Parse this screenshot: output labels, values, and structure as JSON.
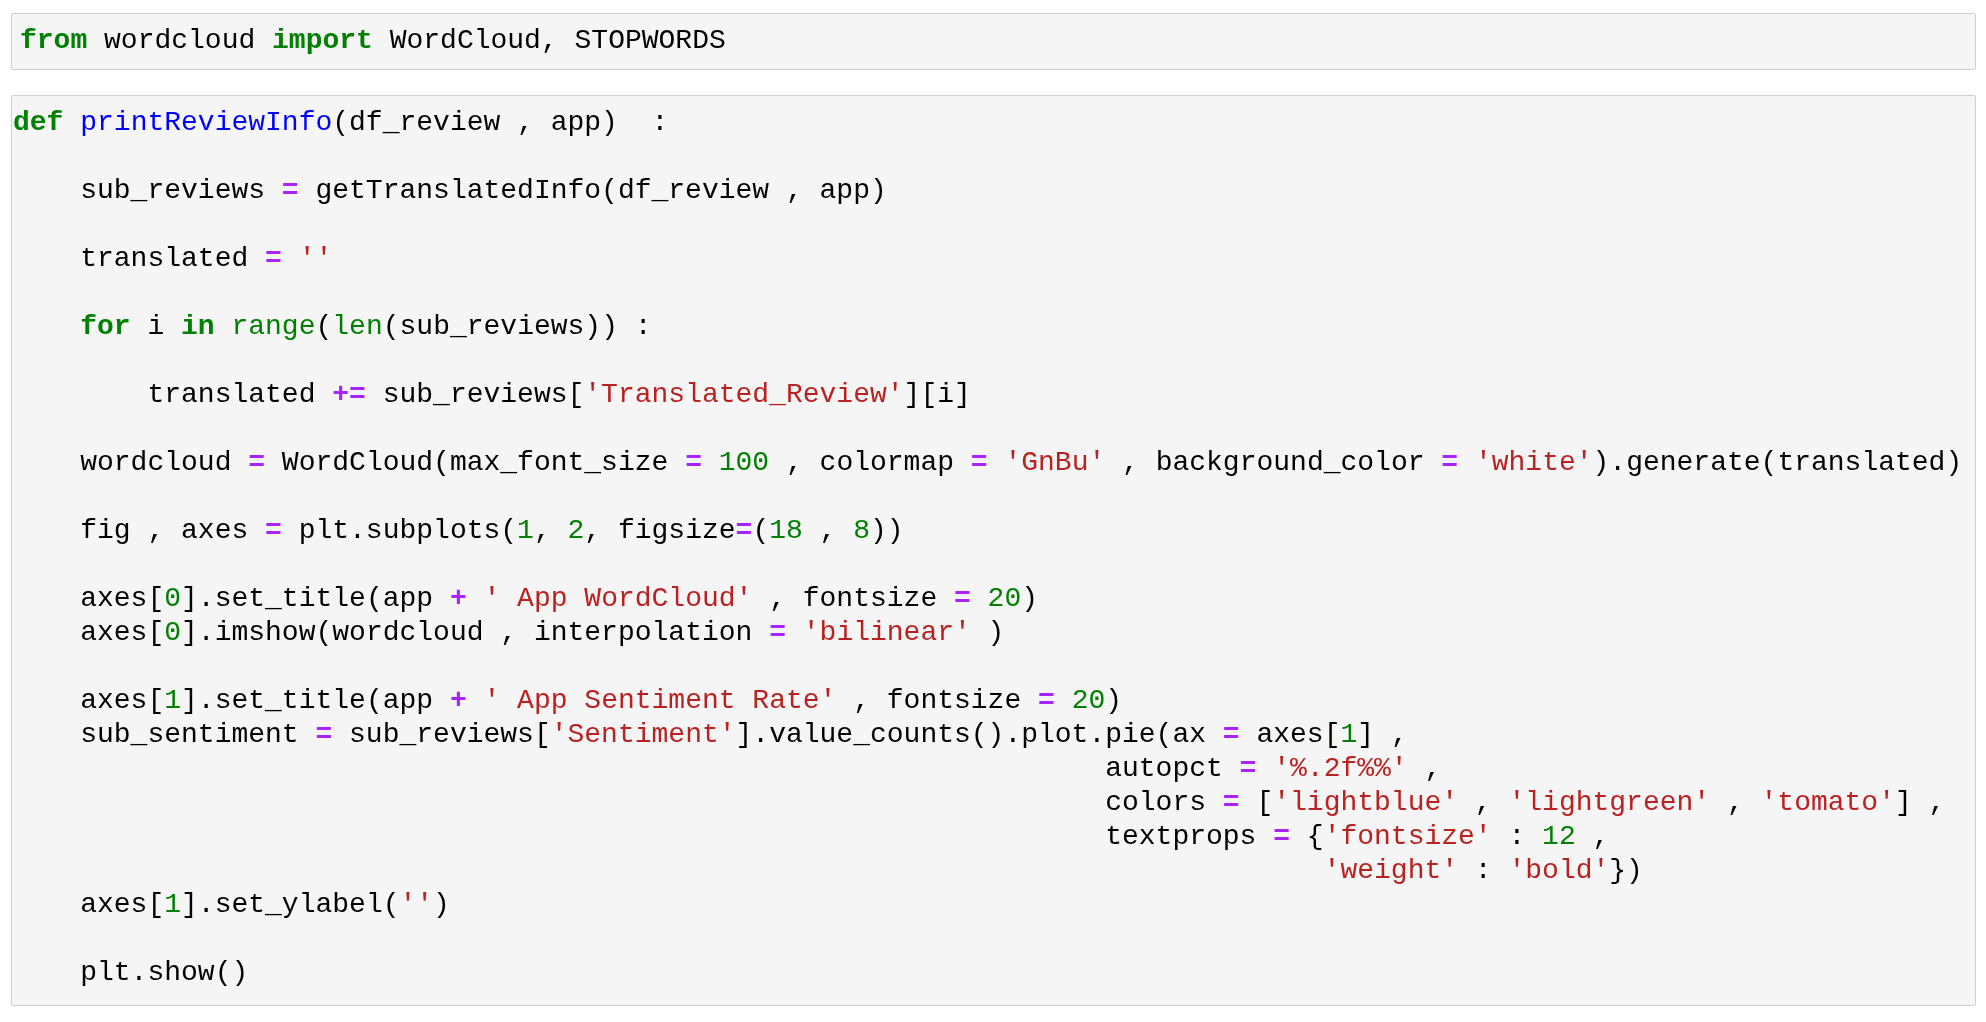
{
  "cells": [
    {
      "lines": [
        {
          "kind": "code",
          "tokens": [
            {
              "kind": "keyword",
              "text": "from"
            },
            {
              "kind": "name",
              "text": " wordcloud "
            },
            {
              "kind": "keyword",
              "text": "import"
            },
            {
              "kind": "name",
              "text": " WordCloud, STOPWORDS"
            }
          ]
        }
      ]
    },
    {
      "lines": [
        {
          "kind": "code",
          "tokens": [
            {
              "kind": "keyword",
              "text": "def "
            },
            {
              "kind": "function",
              "text": "printReviewInfo"
            },
            {
              "kind": "name",
              "text": "(df_review , app)  :"
            }
          ]
        },
        {
          "kind": "blank"
        },
        {
          "kind": "code",
          "tokens": [
            {
              "kind": "name",
              "text": "    sub_reviews "
            },
            {
              "kind": "operator",
              "text": "="
            },
            {
              "kind": "name",
              "text": " getTranslatedInfo(df_review , app)"
            }
          ]
        },
        {
          "kind": "blank"
        },
        {
          "kind": "code",
          "tokens": [
            {
              "kind": "name",
              "text": "    translated "
            },
            {
              "kind": "operator",
              "text": "="
            },
            {
              "kind": "string",
              "text": " ''"
            }
          ]
        },
        {
          "kind": "blank"
        },
        {
          "kind": "code",
          "tokens": [
            {
              "kind": "keyword",
              "text": "    for"
            },
            {
              "kind": "name",
              "text": " i "
            },
            {
              "kind": "keyword",
              "text": "in"
            },
            {
              "kind": "builtin",
              "text": " range"
            },
            {
              "kind": "name",
              "text": "("
            },
            {
              "kind": "builtin",
              "text": "len"
            },
            {
              "kind": "name",
              "text": "(sub_reviews)) :"
            }
          ]
        },
        {
          "kind": "blank"
        },
        {
          "kind": "code",
          "tokens": [
            {
              "kind": "name",
              "text": "        translated "
            },
            {
              "kind": "operator",
              "text": "+="
            },
            {
              "kind": "name",
              "text": " sub_reviews["
            },
            {
              "kind": "string",
              "text": "'Translated_Review'"
            },
            {
              "kind": "name",
              "text": "][i]"
            }
          ]
        },
        {
          "kind": "blank"
        },
        {
          "kind": "code",
          "tokens": [
            {
              "kind": "name",
              "text": "    wordcloud "
            },
            {
              "kind": "operator",
              "text": "="
            },
            {
              "kind": "name",
              "text": " WordCloud(max_font_size "
            },
            {
              "kind": "operator",
              "text": "="
            },
            {
              "kind": "number",
              "text": " 100"
            },
            {
              "kind": "name",
              "text": " , colormap "
            },
            {
              "kind": "operator",
              "text": "="
            },
            {
              "kind": "string",
              "text": " 'GnBu'"
            },
            {
              "kind": "name",
              "text": " , background_color "
            },
            {
              "kind": "operator",
              "text": "="
            },
            {
              "kind": "string",
              "text": " 'white'"
            },
            {
              "kind": "name",
              "text": ").generate(translated)"
            }
          ]
        },
        {
          "kind": "blank"
        },
        {
          "kind": "code",
          "tokens": [
            {
              "kind": "name",
              "text": "    fig , axes "
            },
            {
              "kind": "operator",
              "text": "="
            },
            {
              "kind": "name",
              "text": " plt.subplots("
            },
            {
              "kind": "number",
              "text": "1"
            },
            {
              "kind": "name",
              "text": ", "
            },
            {
              "kind": "number",
              "text": "2"
            },
            {
              "kind": "name",
              "text": ", figsize"
            },
            {
              "kind": "operator",
              "text": "="
            },
            {
              "kind": "name",
              "text": "("
            },
            {
              "kind": "number",
              "text": "18"
            },
            {
              "kind": "name",
              "text": " , "
            },
            {
              "kind": "number",
              "text": "8"
            },
            {
              "kind": "name",
              "text": "))"
            }
          ]
        },
        {
          "kind": "blank"
        },
        {
          "kind": "code",
          "tokens": [
            {
              "kind": "name",
              "text": "    axes["
            },
            {
              "kind": "number",
              "text": "0"
            },
            {
              "kind": "name",
              "text": "].set_title(app "
            },
            {
              "kind": "operator",
              "text": "+"
            },
            {
              "kind": "string",
              "text": " ' App WordCloud'"
            },
            {
              "kind": "name",
              "text": " , fontsize "
            },
            {
              "kind": "operator",
              "text": "="
            },
            {
              "kind": "number",
              "text": " 20"
            },
            {
              "kind": "name",
              "text": ")"
            }
          ]
        },
        {
          "kind": "code",
          "tokens": [
            {
              "kind": "name",
              "text": "    axes["
            },
            {
              "kind": "number",
              "text": "0"
            },
            {
              "kind": "name",
              "text": "].imshow(wordcloud , interpolation "
            },
            {
              "kind": "operator",
              "text": "="
            },
            {
              "kind": "string",
              "text": " 'bilinear'"
            },
            {
              "kind": "name",
              "text": " )"
            }
          ]
        },
        {
          "kind": "blank"
        },
        {
          "kind": "code",
          "tokens": [
            {
              "kind": "name",
              "text": "    axes["
            },
            {
              "kind": "number",
              "text": "1"
            },
            {
              "kind": "name",
              "text": "].set_title(app "
            },
            {
              "kind": "operator",
              "text": "+"
            },
            {
              "kind": "string",
              "text": " ' App Sentiment Rate'"
            },
            {
              "kind": "name",
              "text": " , fontsize "
            },
            {
              "kind": "operator",
              "text": "="
            },
            {
              "kind": "number",
              "text": " 20"
            },
            {
              "kind": "name",
              "text": ")"
            }
          ]
        },
        {
          "kind": "code",
          "tokens": [
            {
              "kind": "name",
              "text": "    sub_sentiment "
            },
            {
              "kind": "operator",
              "text": "="
            },
            {
              "kind": "name",
              "text": " sub_reviews["
            },
            {
              "kind": "string",
              "text": "'Sentiment'"
            },
            {
              "kind": "name",
              "text": "].value_counts().plot.pie(ax "
            },
            {
              "kind": "operator",
              "text": "="
            },
            {
              "kind": "name",
              "text": " axes["
            },
            {
              "kind": "number",
              "text": "1"
            },
            {
              "kind": "name",
              "text": "] ,"
            }
          ]
        },
        {
          "kind": "code",
          "tokens": [
            {
              "kind": "name",
              "text": "                                                                 autopct "
            },
            {
              "kind": "operator",
              "text": "="
            },
            {
              "kind": "string",
              "text": " '%.2f%%'"
            },
            {
              "kind": "name",
              "text": " ,"
            }
          ]
        },
        {
          "kind": "code",
          "tokens": [
            {
              "kind": "name",
              "text": "                                                                 colors "
            },
            {
              "kind": "operator",
              "text": "="
            },
            {
              "kind": "name",
              "text": " ["
            },
            {
              "kind": "string",
              "text": "'lightblue'"
            },
            {
              "kind": "name",
              "text": " , "
            },
            {
              "kind": "string",
              "text": "'lightgreen'"
            },
            {
              "kind": "name",
              "text": " , "
            },
            {
              "kind": "string",
              "text": "'tomato'"
            },
            {
              "kind": "name",
              "text": "] ,"
            }
          ]
        },
        {
          "kind": "code",
          "tokens": [
            {
              "kind": "name",
              "text": "                                                                 textprops "
            },
            {
              "kind": "operator",
              "text": "="
            },
            {
              "kind": "name",
              "text": " {"
            },
            {
              "kind": "string",
              "text": "'fontsize'"
            },
            {
              "kind": "name",
              "text": " : "
            },
            {
              "kind": "number",
              "text": "12"
            },
            {
              "kind": "name",
              "text": " ,"
            }
          ]
        },
        {
          "kind": "code",
          "tokens": [
            {
              "kind": "string",
              "text": "                                                                              'weight'"
            },
            {
              "kind": "name",
              "text": " : "
            },
            {
              "kind": "string",
              "text": "'bold'"
            },
            {
              "kind": "name",
              "text": "})"
            }
          ]
        },
        {
          "kind": "code",
          "tokens": [
            {
              "kind": "name",
              "text": "    axes["
            },
            {
              "kind": "number",
              "text": "1"
            },
            {
              "kind": "name",
              "text": "].set_ylabel("
            },
            {
              "kind": "string",
              "text": "''"
            },
            {
              "kind": "name",
              "text": ")"
            }
          ]
        },
        {
          "kind": "blank"
        },
        {
          "kind": "code",
          "tokens": [
            {
              "kind": "name",
              "text": "    plt.show()"
            }
          ]
        }
      ]
    }
  ]
}
